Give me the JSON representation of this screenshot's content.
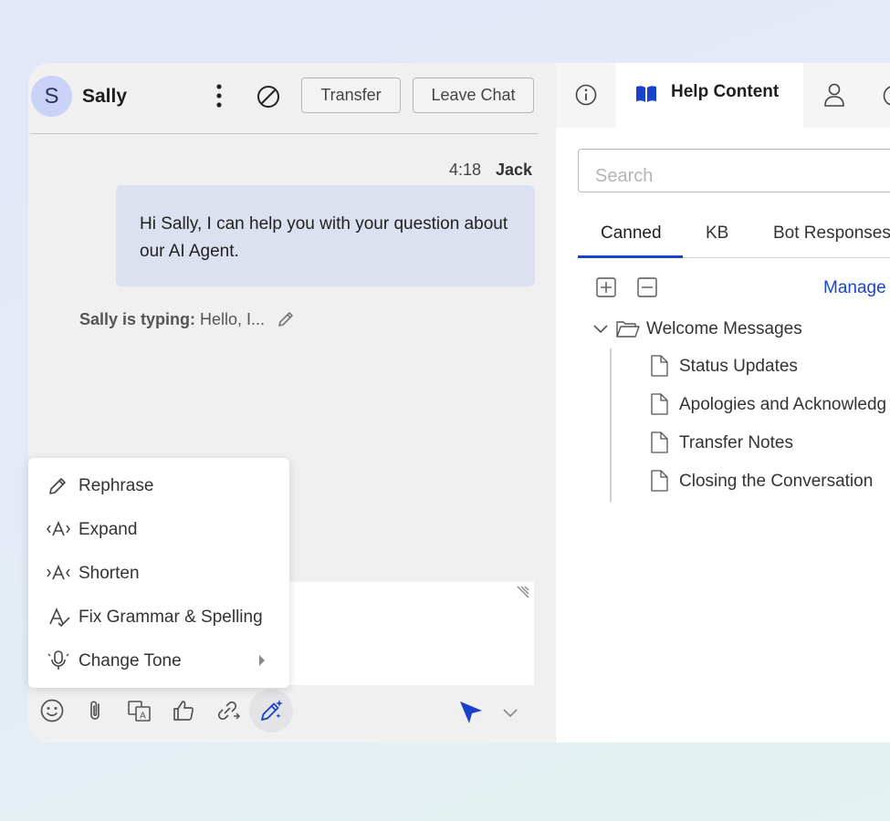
{
  "chat": {
    "avatar_initial": "S",
    "contact_name": "Sally",
    "transfer_label": "Transfer",
    "leave_label": "Leave Chat",
    "message": {
      "time": "4:18",
      "author": "Jack",
      "text": "Hi Sally, I can help you with your question about our AI Agent."
    },
    "typing": {
      "prefix": "Sally is typing:",
      "text": " Hello, I..."
    },
    "toolbar_icons": [
      "emoji-icon",
      "attachment-icon",
      "translate-icon",
      "thumbs-up-icon",
      "link-icon",
      "ai-assist-icon"
    ],
    "send_color": "#1842c9"
  },
  "ai_menu": {
    "items": [
      {
        "label": "Rephrase",
        "icon": "pencil-icon"
      },
      {
        "label": "Expand",
        "icon": "expand-text-icon"
      },
      {
        "label": "Shorten",
        "icon": "shorten-text-icon"
      },
      {
        "label": "Fix Grammar & Spelling",
        "icon": "grammar-check-icon"
      },
      {
        "label": "Change Tone",
        "icon": "tone-icon",
        "has_submenu": true
      }
    ]
  },
  "help": {
    "active_tab_label": "Help Content",
    "search_placeholder": "Search",
    "sub_tabs": [
      "Canned",
      "KB",
      "Bot Responses"
    ],
    "active_sub_tab": "Canned",
    "manage_label": "Manage",
    "folder": {
      "label": "Welcome Messages",
      "items": [
        "Status Updates",
        "Apologies and Acknowledg",
        "Transfer Notes",
        "Closing the Conversation"
      ]
    },
    "accent_color": "#1842c9"
  }
}
